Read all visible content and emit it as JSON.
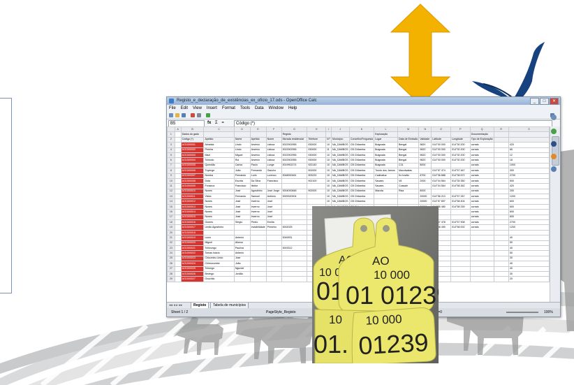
{
  "window": {
    "title": "Registo_e_declaração_de_existências_ex_ofício_17.ods - OpenOffice Calc",
    "buttons": [
      "_",
      "□",
      "✕"
    ]
  },
  "menu": [
    "File",
    "Edit",
    "View",
    "Insert",
    "Format",
    "Tools",
    "Data",
    "Window",
    "Help"
  ],
  "formula": {
    "name_box": "B5",
    "fx": "fx",
    "sum": "Σ",
    "eq": "=",
    "content": "Código (*)"
  },
  "columns": [
    "",
    "A",
    "B",
    "C",
    "D",
    "E",
    "F",
    "G",
    "H",
    "I",
    "J",
    "K",
    "L",
    "M",
    "N",
    "O",
    "P",
    "Q",
    "R",
    "S",
    "T"
  ],
  "rows": [
    {
      "n": "1",
      "cells": [
        "Dados do gado",
        "",
        "",
        "",
        "",
        "Registo",
        "",
        "",
        "",
        "",
        "Exploração",
        "",
        "",
        "",
        "",
        "Documentação",
        "",
        ""
      ]
    },
    {
      "n": "2",
      "cells": [
        "Código (*)",
        "Apelido",
        "Nome",
        "Apelido",
        "Nome",
        "Morada residencial",
        "Telefone",
        "N.º",
        "Município",
        "Concelho/Freguesia",
        "Lugar",
        "Data de Emissão",
        "Validade",
        "Latitude",
        "Longitude",
        "Tipo de Exploração",
        "",
        ""
      ]
    },
    {
      "n": "3",
      "cells": [
        "AO1000001",
        "Almeida",
        "Lindo",
        "Arsénio",
        "Lisboa",
        "0022902955",
        "930000",
        "10",
        "NA_DAMBOS",
        "CB Chilamba",
        "Buigwala",
        "Bengal",
        "9820",
        "014°00 000",
        "014°30 200",
        "corrais",
        "",
        "420"
      ]
    },
    {
      "n": "4",
      "cells": [
        "AO1000002",
        "Pereira",
        "Lindo",
        "Arsénio",
        "Lisboa",
        "0022902955",
        "930000",
        "11",
        "NA_DAMBOS",
        "CB Chilamba",
        "Buigwala",
        "Bengal",
        "9820",
        "014°00 000",
        "014°30 200",
        "corrais",
        "",
        "65"
      ]
    },
    {
      "n": "5",
      "cells": [
        "AO1000003",
        "Mazi",
        "Miguel",
        "Arsénio",
        "Lisboa",
        "0022902955",
        "930000",
        "10",
        "NA_DAMBOS",
        "CB Chilamba",
        "Buigwala",
        "Bengal",
        "9820",
        "014°00 000",
        "014°30 200",
        "corrais",
        "",
        "12"
      ]
    },
    {
      "n": "6",
      "cells": [
        "AO1000004",
        "Tchicolo",
        "Rui",
        "Arsénio",
        "Lisboa",
        "0022902955",
        "930000",
        "10",
        "NA_DAMBOS",
        "CB Chilamba",
        "Buigwala",
        "Bengal",
        "9820",
        "014°00 000",
        "014°30 200",
        "corrais",
        "",
        "18"
      ]
    },
    {
      "n": "7",
      "cells": [
        "AO1000005",
        "Quendão",
        "Carlos",
        "Paulo",
        "Lunge",
        "0019902274",
        "920140",
        "10",
        "NA_DAMBOS",
        "CB Chilamba",
        "Buigwala",
        "C31",
        "8000",
        "",
        "",
        "corrais",
        "",
        "1000"
      ]
    },
    {
      "n": "8",
      "cells": [
        "AO1000006",
        "Tuyenge",
        "João",
        "Fernando",
        "Gaúcho",
        "",
        "902000",
        "10",
        "NA_DAMBOS",
        "CB Chilamba",
        "Tundo dos Jamos",
        "Macolwatas",
        "",
        "014°57 474",
        "014°57 467",
        "corrais",
        "",
        "300"
      ]
    },
    {
      "n": "9",
      "cells": [
        "AO1000007",
        "Nomba",
        "Fernando",
        "Lurin",
        "Lorenzo",
        "0048000461",
        "903220",
        "10",
        "NA_DAMBOS",
        "CB Chilamba",
        "Cadinafua",
        "Ko trarão",
        "8700",
        "014°06 888",
        "014°36 672",
        "corrais",
        "",
        "2700"
      ]
    },
    {
      "n": "10",
      "cells": [
        "AO1000008",
        "Dota",
        "Escrita",
        "Da Silva",
        "Francisco",
        "",
        "902100",
        "10",
        "NA_DAMBOS",
        "CB Chilamba",
        "Sauaes",
        "V6",
        "2000",
        "014°04 564",
        "014°35 350",
        "corrais",
        "",
        "500"
      ]
    },
    {
      "n": "11",
      "cells": [
        "AO1000009",
        "Fonseca",
        "Francisco",
        "Itinibe",
        "",
        "",
        "",
        "10",
        "NA_DAMBOS",
        "CB Chilamba",
        "Sauaes",
        "Cossalé",
        "",
        "014°04 564",
        "014°58 362",
        "corrais",
        "",
        "420"
      ]
    },
    {
      "n": "12",
      "cells": [
        "AO1000010",
        "Nunes",
        "José",
        "Agostinho",
        "José Jorge",
        "0004000848",
        "902000",
        "10",
        "NA_DAMBOS",
        "CB Chilamba",
        "Macuta",
        "Risa",
        "8000",
        "",
        "",
        "corrais",
        "",
        "200"
      ]
    },
    {
      "n": "13",
      "cells": [
        "AO1000011",
        "Vieira",
        "Fernando",
        "Samuel",
        "Antônio",
        "0009320004",
        "",
        "10",
        "NA_DAMBOS",
        "CB Chilamba",
        "",
        "",
        "20000",
        "014°56 213",
        "014°57 267",
        "corrais",
        "",
        "1200"
      ]
    },
    {
      "n": "14",
      "cells": [
        "AO1000012",
        "Nunes",
        "José",
        "Inverno",
        "José",
        "",
        "",
        "10",
        "NA_DAMBOS",
        "CB Chilamba",
        "",
        "",
        "20000",
        "014°57 897",
        "014°58 404",
        "corrais",
        "",
        "600"
      ]
    },
    {
      "n": "15",
      "cells": [
        "AO1000013",
        "Nunes",
        "José",
        "Inverno",
        "José",
        "",
        "",
        "10",
        "NA_DAMBOS",
        "CB Chilamba",
        "",
        "",
        "20000",
        "014°56 480",
        "014°58 339",
        "corrais",
        "",
        "600"
      ]
    },
    {
      "n": "16",
      "cells": [
        "AO1000014",
        "Nunes",
        "José",
        "Inverno",
        "José",
        "",
        "",
        "10",
        "NA_DAMBOS",
        "CB Chilamba",
        "",
        "",
        "",
        "",
        "",
        "corrais",
        "",
        "600"
      ]
    },
    {
      "n": "17",
      "cells": [
        "AO1000015",
        "Nunes",
        "José",
        "Inverno",
        "José",
        "",
        "",
        "10",
        "NA_DAMBOS",
        "CB Chilamba",
        "",
        "",
        "",
        "",
        "",
        "corrais",
        "",
        "600"
      ]
    },
    {
      "n": "18",
      "cells": [
        "AO1000016",
        "Gomes",
        "Sérgio",
        "Pedro",
        "Emília",
        "",
        "",
        "10",
        "NA_DAMBOS",
        "CB Chilamba",
        "",
        "",
        "",
        "014°57 478",
        "014°57 908",
        "corrais",
        "",
        "2700"
      ]
    },
    {
      "n": "19",
      "cells": [
        "AO1000017",
        "Limão Agostinho",
        "",
        "Inviabilidade",
        "Primeiro",
        "0002025",
        "",
        "10",
        "NA_DAMBOS",
        "CB Chilamba",
        "",
        "",
        "",
        "014°56 490",
        "014°56 002",
        "corrais",
        "",
        "1200"
      ]
    },
    {
      "n": "20",
      "cells": [
        "AO1000018",
        "",
        "",
        "",
        "",
        "",
        "",
        "",
        "",
        "",
        "",
        "",
        "",
        "",
        "",
        "",
        "",
        ""
      ]
    },
    {
      "n": "21",
      "cells": [
        "AO1000019",
        "Lúcio",
        "Antenio",
        "",
        "",
        "0049931",
        "",
        "",
        "",
        "",
        "",
        "",
        "",
        "",
        "",
        "",
        "",
        "40"
      ]
    },
    {
      "n": "22",
      "cells": [
        "AO1000020",
        "Miguel",
        "Afonso",
        "",
        "",
        "",
        "",
        "",
        "",
        "",
        "",
        "",
        "",
        "",
        "",
        "",
        "",
        "50"
      ]
    },
    {
      "n": "23",
      "cells": [
        "AO1000021",
        "Tchivungo",
        "Paulina",
        "",
        "",
        "0003312",
        "",
        "",
        "",
        "",
        "",
        "",
        "",
        "",
        "",
        "",
        "",
        "40"
      ]
    },
    {
      "n": "24",
      "cells": [
        "AO1000022",
        "Tomas Inácio",
        "Antenio",
        "",
        "",
        "",
        "",
        "",
        "",
        "",
        "",
        "",
        "",
        "",
        "",
        "",
        "",
        "50"
      ]
    },
    {
      "n": "25",
      "cells": [
        "AO1000023",
        "Chicumbu Lindo",
        "Jose",
        "",
        "",
        "",
        "",
        "",
        "",
        "",
        "",
        "",
        "",
        "",
        "",
        "",
        "",
        "30"
      ]
    },
    {
      "n": "26",
      "cells": [
        "AO1000024",
        "Chimuxumbe",
        "João",
        "",
        "",
        "",
        "",
        "",
        "",
        "",
        "",
        "",
        "",
        "",
        "",
        "",
        "",
        "40"
      ]
    },
    {
      "n": "27",
      "cells": [
        "AO1000025",
        "Tchongo",
        "Ngunde",
        "",
        "",
        "",
        "",
        "",
        "",
        "",
        "",
        "",
        "",
        "",
        "",
        "",
        "",
        "40"
      ]
    },
    {
      "n": "28",
      "cells": [
        "AO1000026",
        "Bevingo",
        "Jordão",
        "",
        "",
        "",
        "",
        "",
        "",
        "",
        "",
        "",
        "",
        "",
        "",
        "",
        "",
        "30"
      ]
    },
    {
      "n": "29",
      "cells": [
        "AO1000027",
        "Ovuchilo",
        "",
        "",
        "",
        "",
        "",
        "",
        "",
        "",
        "",
        "",
        "",
        "",
        "",
        "",
        "",
        "20"
      ]
    }
  ],
  "sheet_tabs": [
    "Registo",
    "Tabela de municípios"
  ],
  "status": {
    "sheet": "Sheet 1 / 2",
    "style": "PageStyle_Registo",
    "sum": "Sum=0",
    "zoom": "100%"
  },
  "tags": {
    "back": {
      "country": "AO",
      "top": "10 000",
      "bottom": "01 01239"
    },
    "front": {
      "country": "AO",
      "top": "10 000",
      "bottom": "01 01239"
    },
    "lower_back": {
      "top": "10",
      "bottom": "01."
    },
    "lower_front": {
      "top": "10 000",
      "bottom": "01239"
    }
  },
  "colors": {
    "arrow": "#f3b100",
    "bird": "#16427f",
    "tag": "#e9e56a",
    "code_cell": "#d7332f",
    "animals": "#9a9a9a"
  }
}
